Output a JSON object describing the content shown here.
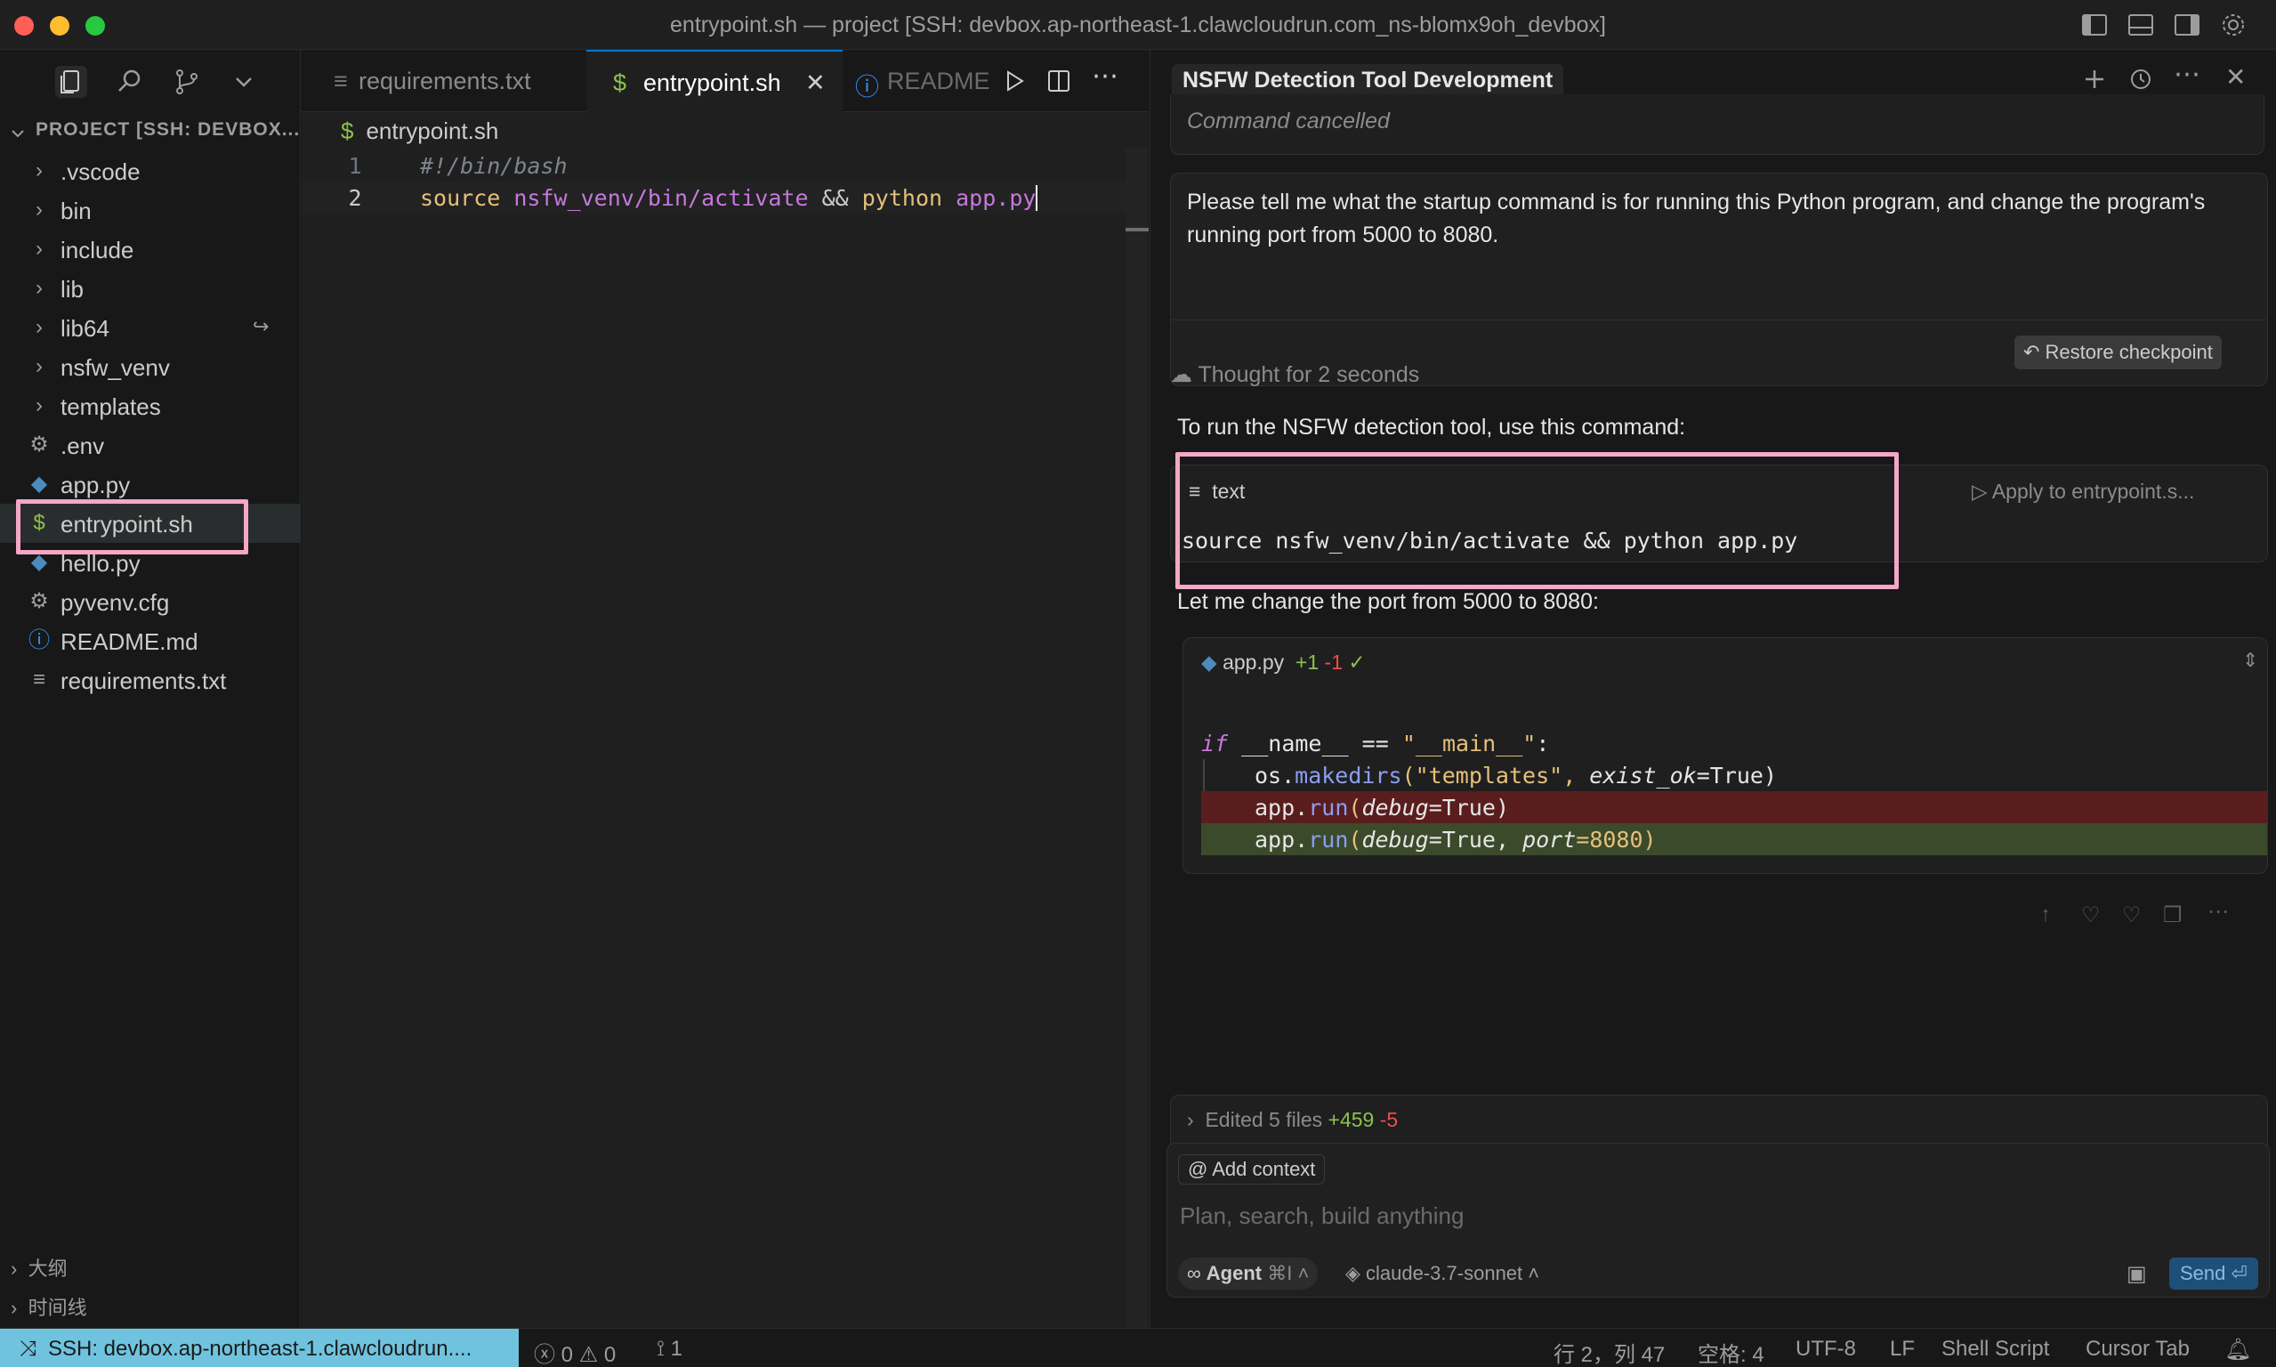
{
  "window": {
    "title": "entrypoint.sh — project [SSH: devbox.ap-northeast-1.clawcloudrun.com_ns-blomx9oh_devbox]"
  },
  "sidebar": {
    "header": "PROJECT [SSH: DEVBOX...",
    "items": [
      {
        "label": ".vscode",
        "kind": "folder"
      },
      {
        "label": "bin",
        "kind": "folder"
      },
      {
        "label": "include",
        "kind": "folder"
      },
      {
        "label": "lib",
        "kind": "folder"
      },
      {
        "label": "lib64",
        "kind": "folder"
      },
      {
        "label": "nsfw_venv",
        "kind": "folder"
      },
      {
        "label": "templates",
        "kind": "folder"
      },
      {
        "label": ".env",
        "kind": "gear"
      },
      {
        "label": "app.py",
        "kind": "python"
      },
      {
        "label": "entrypoint.sh",
        "kind": "shell"
      },
      {
        "label": "hello.py",
        "kind": "python"
      },
      {
        "label": "pyvenv.cfg",
        "kind": "gear"
      },
      {
        "label": "README.md",
        "kind": "info"
      },
      {
        "label": "requirements.txt",
        "kind": "text"
      }
    ],
    "outline": "大纲",
    "timeline": "时间线"
  },
  "editor": {
    "tabs": [
      {
        "label": "requirements.txt"
      },
      {
        "label": "entrypoint.sh"
      },
      {
        "label": "README"
      }
    ],
    "breadcrumb": "entrypoint.sh",
    "lines": [
      {
        "num": "1",
        "text": "#!/bin/bash"
      },
      {
        "num": "2",
        "text": "source nsfw_venv/bin/activate && python app.py"
      }
    ],
    "code_tokens": {
      "source": "source",
      "path": "nsfw_venv/bin/activate",
      "and": "&&",
      "python": "python",
      "file": "app.py"
    }
  },
  "chat": {
    "title": "NSFW Detection Tool Development",
    "cancelled": "Command cancelled",
    "user_message": [
      "Please tell me what the startup command is for running this Python program, and change the program's",
      "running port from 5000 to 8080."
    ],
    "restore_label": "Restore checkpoint",
    "thought": "Thought for 2 seconds",
    "intro": "To run the NSFW detection tool, use this command:",
    "code_lang": "text",
    "apply_label": "Apply to entrypoint.s...",
    "command": "source nsfw_venv/bin/activate && python app.py",
    "port_msg": "Let me change the port from 5000 to 8080:",
    "diff": {
      "file": "app.py",
      "added": "+1",
      "removed": "-1",
      "lines": [
        {
          "text": "if __name__ == \"__main__\":"
        },
        {
          "text": "    os.makedirs(\"templates\", exist_ok=True)"
        },
        {
          "text": "    app.run(debug=True)"
        },
        {
          "text": "    app.run(debug=True, port=8080)"
        }
      ],
      "tokens": {
        "if": "if",
        "name": "__name__",
        "eq": "==",
        "main": "\"__main__\"",
        "colon": ":",
        "os": "os.",
        "makedirs": "makedirs",
        "templates": "(\"templates\", ",
        "exist_ok": "exist_ok",
        "true_close": "=True)",
        "app": "app.",
        "run": "run",
        "paren": "(",
        "debug": "debug",
        "true_only": "=True)",
        "true_comma": "=True, ",
        "port": "port",
        "port_val": "=8080",
        "close": ")"
      }
    },
    "edited": {
      "label": "Edited 5 files",
      "added": "+459",
      "removed": "-5"
    },
    "add_context": "Add context",
    "input_placeholder": "Plan, search, build anything",
    "agent_label": "Agent",
    "agent_shortcut": "⌘I",
    "model": "claude-3.7-sonnet",
    "send_label": "Send"
  },
  "statusbar": {
    "remote": "SSH: devbox.ap-northeast-1.clawcloudrun....",
    "errors": "0",
    "warnings": "0",
    "ports": "1",
    "position": "行 2，列 47",
    "spaces": "空格: 4",
    "encoding": "UTF-8",
    "eol": "LF",
    "language": "Shell Script",
    "cursor_tab": "Cursor Tab"
  },
  "colors": {
    "accent": "#6fc3df",
    "highlight": "#f4a7c6",
    "removed_bg": "#5a1d1d",
    "added_bg": "#3b4a2a"
  }
}
